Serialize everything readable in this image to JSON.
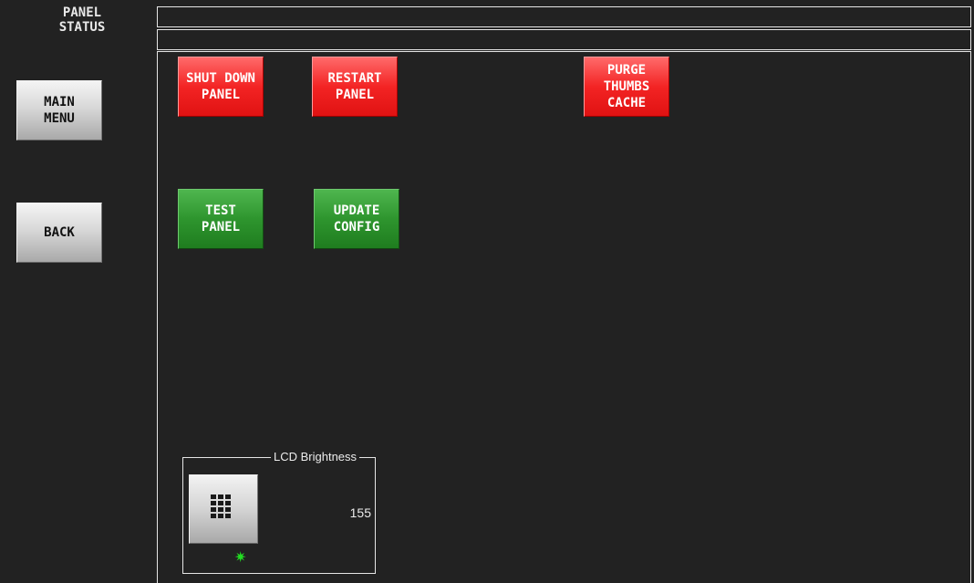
{
  "page": {
    "title": "PANEL\nSTATUS"
  },
  "status": {
    "line1": "",
    "line2": ""
  },
  "nav": {
    "main_menu_label": "MAIN\nMENU",
    "back_label": "BACK"
  },
  "actions": {
    "shut_down_label": "SHUT DOWN\nPANEL",
    "restart_label": "RESTART\nPANEL",
    "purge_label": "PURGE\nTHUMBS\nCACHE",
    "test_label": "TEST\nPANEL",
    "update_label": "UPDATE\nCONFIG"
  },
  "lcd": {
    "group_title": "LCD Brightness",
    "value": "155",
    "keypad_icon": "keypad-grid-icon",
    "indicator_icon": "green-star-indicator-icon",
    "indicator_glyph": "✷"
  },
  "colors": {
    "background": "#222222",
    "danger": "#f32424",
    "success": "#2e952e",
    "neutral": "#d4d4d4",
    "indicator": "#22dd22"
  }
}
